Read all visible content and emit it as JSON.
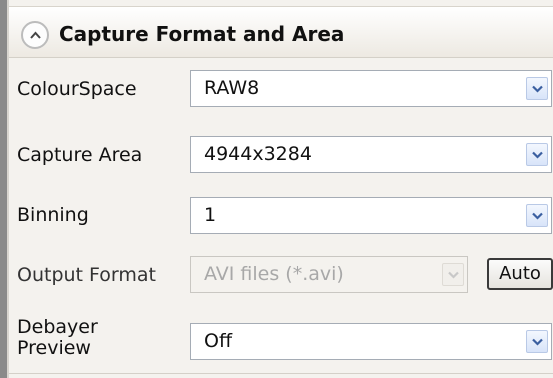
{
  "section": {
    "title": "Capture Format and Area",
    "collapse_icon": "chevron-up-icon"
  },
  "rows": {
    "colourspace": {
      "label": "ColourSpace",
      "value": "RAW8"
    },
    "capture_area": {
      "label": "Capture Area",
      "value": "4944x3284"
    },
    "binning": {
      "label": "Binning",
      "value": "1"
    },
    "output_format": {
      "label": "Output Format",
      "value": "AVI files (*.avi)",
      "button": "Auto"
    },
    "debayer": {
      "label_line1": "Debayer",
      "label_line2": "Preview",
      "value": "Off"
    }
  },
  "colors": {
    "accent": "#3a5fa0",
    "disabled_text": "#a8a8a8"
  }
}
